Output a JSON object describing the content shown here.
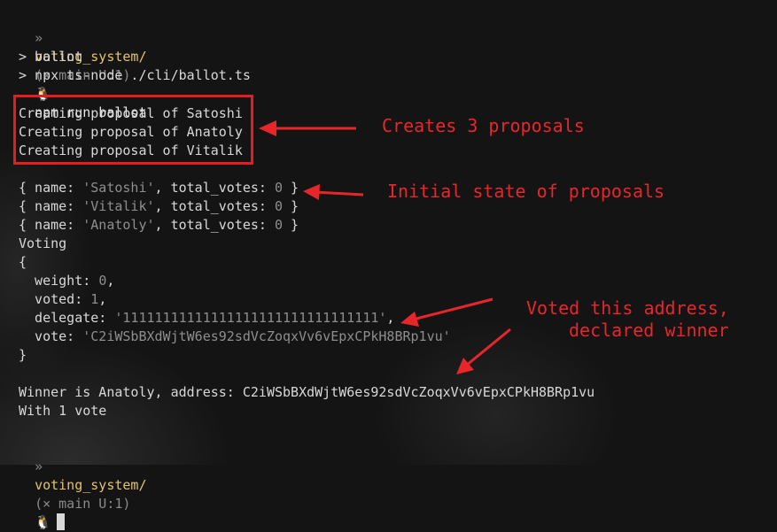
{
  "prompt_top": {
    "symbol": "»",
    "dir": "voting_system/",
    "git": "(× main U:1)",
    "icon": "🐧",
    "command": "npm run ballot"
  },
  "npm_lines": [
    "> ballot",
    "> npx ts-node ./cli/ballot.ts"
  ],
  "creating_lines": [
    "Creating proposal of Satoshi",
    "Creating proposal of Anatoly",
    "Creating proposal of Vitalik"
  ],
  "proposals": [
    {
      "pre": "{ name: ",
      "name": "'Satoshi'",
      "mid": ", total_votes: ",
      "votes": "0",
      "post": " }"
    },
    {
      "pre": "{ name: ",
      "name": "'Vitalik'",
      "mid": ", total_votes: ",
      "votes": "0",
      "post": " }"
    },
    {
      "pre": "{ name: ",
      "name": "'Anatoly'",
      "mid": ", total_votes: ",
      "votes": "0",
      "post": " }"
    }
  ],
  "voting_label": "Voting",
  "obj_open": "{",
  "voter": {
    "weight_key": "  weight: ",
    "weight_val": "0",
    "voted_key": "  voted: ",
    "voted_val": "1",
    "delegate_key": "  delegate: ",
    "delegate_val": "'11111111111111111111111111111111'",
    "vote_key": "  vote: ",
    "vote_val": "'C2iWSbBXdWjtW6es92sdVcZoqxVv6vEpxCPkH8BRp1vu'"
  },
  "obj_close": "}",
  "winner_line": "Winner is Anatoly, address: C2iWSbBXdWjtW6es92sdVcZoqxVv6vEpxCPkH8BRp1vu",
  "votes_line": "With 1 vote",
  "prompt_bottom": {
    "symbol": "»",
    "dir": "voting_system/",
    "git": "(× main U:1)",
    "icon": "🐧"
  },
  "annotations": {
    "creates": "Creates 3 proposals",
    "initial": "Initial state of proposals",
    "voted_line1": "Voted this address,",
    "voted_line2": "declared winner"
  },
  "colors": {
    "annotation_red": "#e8262a",
    "prompt_dir_yellow": "#e3c46b",
    "string_gray": "#8e8e8e"
  }
}
